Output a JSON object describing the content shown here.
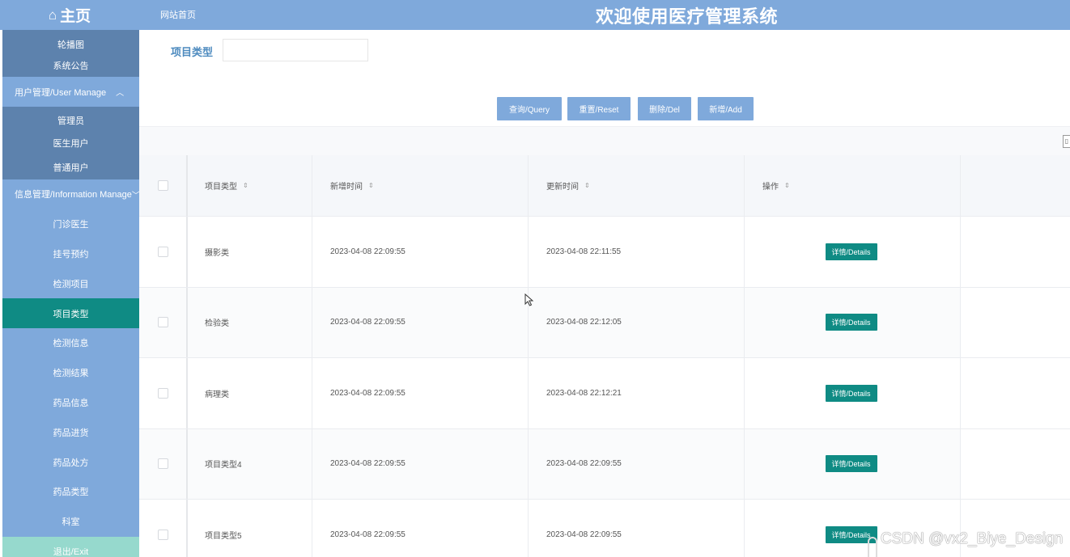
{
  "header": {
    "home_label": "主页",
    "site_link": "网站首页",
    "title": "欢迎使用医疗管理系统"
  },
  "sidebar": {
    "items": [
      {
        "label": "轮播图",
        "kind": "sub"
      },
      {
        "label": "系统公告",
        "kind": "sub"
      },
      {
        "label": "用户管理/User Manage",
        "kind": "group",
        "chevron": "^"
      },
      {
        "label": "管理员",
        "kind": "sub"
      },
      {
        "label": "医生用户",
        "kind": "sub"
      },
      {
        "label": "普通用户",
        "kind": "sub"
      },
      {
        "label": "信息管理/Information Manage",
        "kind": "group",
        "chevron": "v"
      },
      {
        "label": "门诊医生",
        "kind": "item"
      },
      {
        "label": "挂号预约",
        "kind": "item"
      },
      {
        "label": "检测项目",
        "kind": "item"
      },
      {
        "label": "项目类型",
        "kind": "item",
        "active": true
      },
      {
        "label": "检测信息",
        "kind": "item"
      },
      {
        "label": "检测结果",
        "kind": "item"
      },
      {
        "label": "药品信息",
        "kind": "item"
      },
      {
        "label": "药品进货",
        "kind": "item"
      },
      {
        "label": "药品处方",
        "kind": "item"
      },
      {
        "label": "药品类型",
        "kind": "item"
      },
      {
        "label": "科室",
        "kind": "item"
      },
      {
        "label": "退出/Exit",
        "kind": "exit"
      }
    ]
  },
  "search": {
    "label": "项目类型",
    "value": "",
    "placeholder": ""
  },
  "buttons": {
    "query": "查询/Query",
    "reset": "重置/Reset",
    "delete": "删除/Del",
    "add": "新增/Add"
  },
  "table": {
    "columns": [
      "项目类型",
      "新增时间",
      "更新时间",
      "操作"
    ],
    "rows": [
      {
        "type": "摄影类",
        "added": "2023-04-08 22:09:55",
        "updated": "2023-04-08 22:11:55",
        "action": "详情/Details"
      },
      {
        "type": "检验类",
        "added": "2023-04-08 22:09:55",
        "updated": "2023-04-08 22:12:05",
        "action": "详情/Details"
      },
      {
        "type": "病理类",
        "added": "2023-04-08 22:09:55",
        "updated": "2023-04-08 22:12:21",
        "action": "详情/Details"
      },
      {
        "type": "项目类型4",
        "added": "2023-04-08 22:09:55",
        "updated": "2023-04-08 22:09:55",
        "action": "详情/Details"
      },
      {
        "type": "项目类型5",
        "added": "2023-04-08 22:09:55",
        "updated": "2023-04-08 22:09:55",
        "action": "详情/Details"
      }
    ]
  },
  "watermark": "CSDN @vx2_Biye_Design",
  "colors": {
    "primary": "#7fa9db",
    "sidebar_sub": "#5d82ad",
    "active": "#0f8b84",
    "exit": "#96d9cd"
  }
}
